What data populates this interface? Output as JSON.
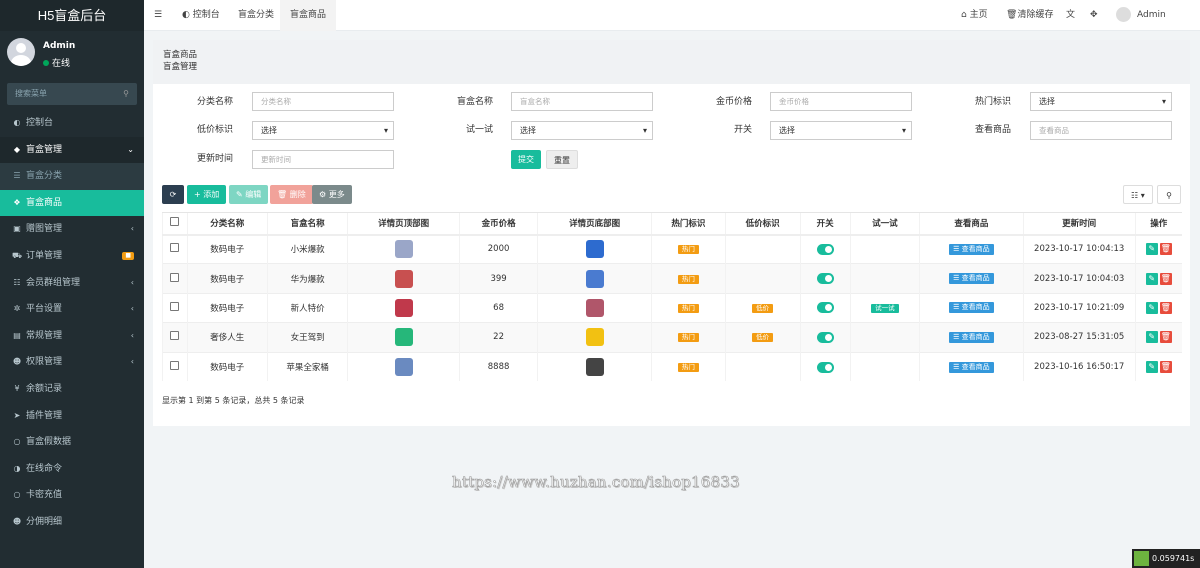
{
  "app": {
    "title": "H5盲盒后台"
  },
  "user": {
    "name": "Admin",
    "status": "在线"
  },
  "sidebar": {
    "search_placeholder": "搜索菜单",
    "items": [
      {
        "label": "控制台",
        "icon": "dashboard-icon",
        "glyph": "◐"
      },
      {
        "label": "盲盒管理",
        "icon": "cube-icon",
        "glyph": "◆",
        "arrow": "⌄"
      },
      {
        "label": "盲盒分类",
        "icon": "list-icon",
        "glyph": "☰"
      },
      {
        "label": "盲盒商品",
        "icon": "cubes-icon",
        "glyph": "❖"
      },
      {
        "label": "赠图管理",
        "icon": "gift-icon",
        "glyph": "▣",
        "arrow": "‹"
      },
      {
        "label": "订单管理",
        "icon": "cart-icon",
        "glyph": "⛟",
        "badge": "■"
      },
      {
        "label": "会员群组管理",
        "icon": "users-icon",
        "glyph": "☷",
        "arrow": "‹"
      },
      {
        "label": "平台设置",
        "icon": "gear-icon",
        "glyph": "✲",
        "arrow": "‹"
      },
      {
        "label": "常规管理",
        "icon": "briefcase-icon",
        "glyph": "▤",
        "arrow": "‹"
      },
      {
        "label": "权限管理",
        "icon": "group-icon",
        "glyph": "☻",
        "arrow": "‹"
      },
      {
        "label": "余额记录",
        "icon": "yen-icon",
        "glyph": "¥"
      },
      {
        "label": "插件管理",
        "icon": "rocket-icon",
        "glyph": "➤"
      },
      {
        "label": "盲盒假数据",
        "icon": "circle-icon",
        "glyph": "○"
      },
      {
        "label": "在线命令",
        "icon": "adjust-icon",
        "glyph": "◑"
      },
      {
        "label": "卡密充值",
        "icon": "circle-icon",
        "glyph": "○"
      },
      {
        "label": "分佣明细",
        "icon": "users-icon",
        "glyph": "☻"
      }
    ]
  },
  "topbar": {
    "menu_icon": "☰",
    "tabs": [
      {
        "label": "控制台",
        "icon": "dashboard-icon",
        "glyph": "◐"
      },
      {
        "label": "盲盒分类"
      },
      {
        "label": "盲盒商品"
      }
    ],
    "right": {
      "home": "主页",
      "clear_cache": "清除缓存",
      "admin": "Admin",
      "translate_glyph": "文",
      "fullscreen_glyph": "✥"
    }
  },
  "page": {
    "title": "盲盒商品",
    "subtitle": "盲盒管理"
  },
  "filters": {
    "category_label": "分类名称",
    "category_placeholder": "分类名称",
    "name_label": "盲盒名称",
    "name_placeholder": "盲盒名称",
    "price_label": "金币价格",
    "price_placeholder": "金币价格",
    "hot_label": "热门标识",
    "hot_value": "选择",
    "low_label": "低价标识",
    "low_value": "选择",
    "trial_label": "试一试",
    "trial_value": "选择",
    "switch_label": "开关",
    "switch_value": "选择",
    "view_label": "查看商品",
    "view_placeholder": "查看商品",
    "updated_label": "更新时间",
    "updated_placeholder": "更新时间",
    "submit": "提交",
    "reset": "重置"
  },
  "toolbar": {
    "refresh": "⟳",
    "add": "+ 添加",
    "edit": "✎ 编辑",
    "delete": "🗑 删除",
    "more": "⚙ 更多",
    "columns": "☷ ▾",
    "search": "⚲"
  },
  "table": {
    "headers": [
      "分类名称",
      "盲盒名称",
      "详情页顶部图",
      "金币价格",
      "详情页底部图",
      "热门标识",
      "低价标识",
      "开关",
      "试一试",
      "查看商品",
      "更新时间",
      "操作"
    ],
    "rows": [
      {
        "category": "数码电子",
        "name": "小米爆款",
        "price": "2000",
        "hot": "热门",
        "low": "",
        "trial": "",
        "view": "☰ 查看商品",
        "updated": "2023-10-17 10:04:13",
        "top_color": "#9aa6c8",
        "bottom_color": "#2d6bcf"
      },
      {
        "category": "数码电子",
        "name": "华为爆款",
        "price": "399",
        "hot": "热门",
        "low": "",
        "trial": "",
        "view": "☰ 查看商品",
        "updated": "2023-10-17 10:04:03",
        "top_color": "#c85050",
        "bottom_color": "#4a7bd0"
      },
      {
        "category": "数码电子",
        "name": "新人特价",
        "price": "68",
        "hot": "热门",
        "low": "低价",
        "trial": "试一试",
        "view": "☰ 查看商品",
        "updated": "2023-10-17 10:21:09",
        "top_color": "#c0394b",
        "bottom_color": "#b0566a"
      },
      {
        "category": "奢侈人生",
        "name": "女王驾到",
        "price": "22",
        "hot": "热门",
        "low": "低价",
        "trial": "",
        "view": "☰ 查看商品",
        "updated": "2023-08-27 15:31:05",
        "top_color": "#26b77a",
        "bottom_color": "#f2c112"
      },
      {
        "category": "数码电子",
        "name": "苹果全家桶",
        "price": "8888",
        "hot": "热门",
        "low": "",
        "trial": "",
        "view": "☰ 查看商品",
        "updated": "2023-10-16 16:50:17",
        "top_color": "#6a8ac0",
        "bottom_color": "#444444"
      }
    ]
  },
  "pagination": {
    "info": "显示第 1 到第 5 条记录，总共 5 条记录"
  },
  "watermark": "https://www.huzhan.com/ishop16833",
  "timer": {
    "value": "0.059741s"
  },
  "colors": {
    "accent": "#18bc9c",
    "sidebar": "#222d32",
    "danger": "#e74c3c",
    "warning": "#f39c12",
    "info": "#3498db"
  }
}
